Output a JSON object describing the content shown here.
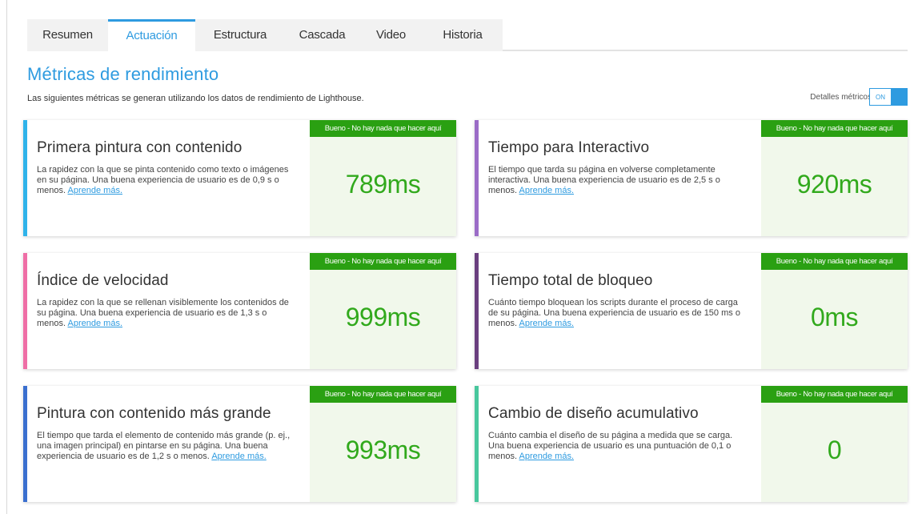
{
  "tabs": [
    {
      "label": "Resumen",
      "active": false
    },
    {
      "label": "Actuación",
      "active": true
    },
    {
      "label": "Estructura",
      "active": false
    },
    {
      "label": "Cascada",
      "active": false
    },
    {
      "label": "Video",
      "active": false
    },
    {
      "label": "Historia",
      "active": false
    }
  ],
  "header": {
    "title": "Métricas de rendimiento",
    "subtitle": "Las siguientes métricas se generan utilizando los datos de rendimiento de Lighthouse."
  },
  "toggle": {
    "label": "Detalles métricos",
    "state": "ON"
  },
  "colors": {
    "accent": "#2e9be0",
    "good_green": "#2aa012",
    "value_green": "#31a91c",
    "value_bg": "#f1f8eb",
    "stripe_fcp": "#2fb3ea",
    "stripe_tti": "#9b6cc7",
    "stripe_si": "#ef6ea6",
    "stripe_tbt": "#6a3f7f",
    "stripe_lcp": "#3a6fcf",
    "stripe_cls": "#48c79d"
  },
  "metrics": [
    {
      "name": "Primera pintura con contenido",
      "description": "La rapidez con la que se pinta contenido como texto o imágenes en su página. Una buena experiencia de usuario es de 0,9 s o menos.",
      "link": "Aprende más.",
      "badge": "Bueno - No hay nada que hacer aquí",
      "value": "789ms"
    },
    {
      "name": "Tiempo para Interactivo",
      "description": "El tiempo que tarda su página en volverse completamente interactiva. Una buena experiencia de usuario es de 2,5 s o menos.",
      "link": "Aprende más.",
      "badge": "Bueno - No hay nada que hacer aquí",
      "value": "920ms"
    },
    {
      "name": "Índice de velocidad",
      "description": "La rapidez con la que se rellenan visiblemente los contenidos de su página. Una buena experiencia de usuario es de 1,3 s o menos.",
      "link": "Aprende más.",
      "badge": "Bueno - No hay nada que hacer aquí",
      "value": "999ms"
    },
    {
      "name": "Tiempo total de bloqueo",
      "description": "Cuánto tiempo bloquean los scripts durante el proceso de carga de su página. Una buena experiencia de usuario es de 150 ms o menos.",
      "link": "Aprende más.",
      "badge": "Bueno - No hay nada que hacer aquí",
      "value": "0ms"
    },
    {
      "name": "Pintura con contenido más grande",
      "description": "El tiempo que tarda el elemento de contenido más grande (p. ej., una imagen principal) en pintarse en su página. Una buena experiencia de usuario es de 1,2 s o menos.",
      "link": "Aprende más.",
      "badge": "Bueno - No hay nada que hacer aquí",
      "value": "993ms"
    },
    {
      "name": "Cambio de diseño acumulativo",
      "description": "Cuánto cambia el diseño de su página a medida que se carga. Una buena experiencia de usuario es una puntuación de 0,1 o menos.",
      "link": "Aprende más.",
      "badge": "Bueno - No hay nada que hacer aquí",
      "value": "0"
    }
  ]
}
